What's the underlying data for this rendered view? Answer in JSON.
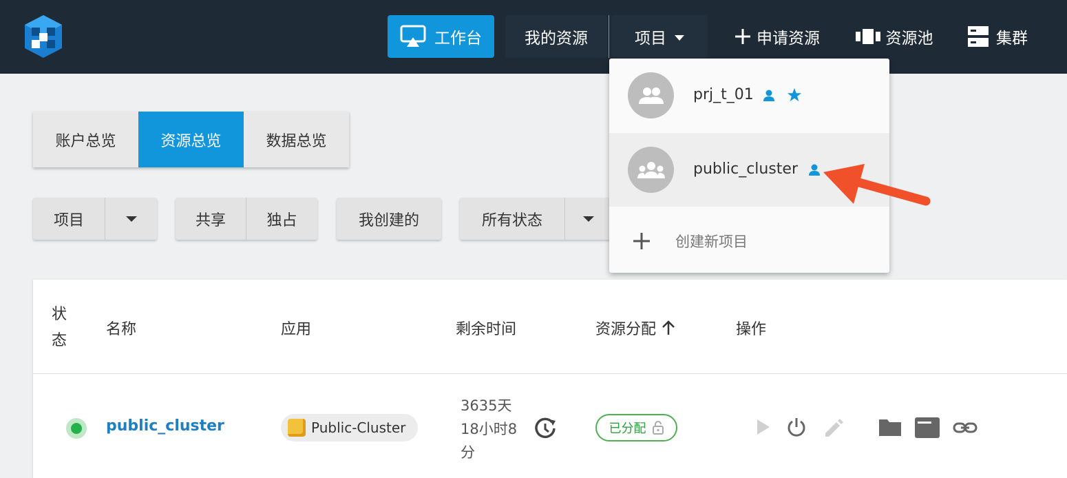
{
  "nav": {
    "workbench": "工作台",
    "my_resources": "我的资源",
    "project": "项目",
    "apply_resources": "申请资源",
    "resource_pool": "资源池",
    "cluster": "集群"
  },
  "overview_tabs": [
    "账户总览",
    "资源总览",
    "数据总览"
  ],
  "active_tab": "资源总览",
  "filters": {
    "project": "项目",
    "shared": "共享",
    "exclusive": "独占",
    "created_by_me": "我创建的",
    "all_status": "所有状态"
  },
  "table": {
    "headers": {
      "status": "状态",
      "name": "名称",
      "app": "应用",
      "remaining_time": "剩余时间",
      "allocation": "资源分配",
      "actions": "操作"
    },
    "rows": [
      {
        "name": "public_cluster",
        "app": "Public-Cluster",
        "remaining_time": "3635天18小时8分",
        "remaining_lines": [
          "3635天",
          "18小时8",
          "分"
        ],
        "allocation": "已分配"
      }
    ]
  },
  "project_dropdown": {
    "items": [
      {
        "name": "prj_t_01",
        "icons": [
          "person-icon",
          "star-icon"
        ]
      },
      {
        "name": "public_cluster",
        "icons": [
          "person-icon"
        ]
      }
    ],
    "create_label": "创建新项目"
  },
  "colors": {
    "topbar": "#1e2a36",
    "accent": "#1296db",
    "link": "#1e7fc2",
    "success": "#25b14a",
    "annotation_arrow": "#f0502a"
  }
}
